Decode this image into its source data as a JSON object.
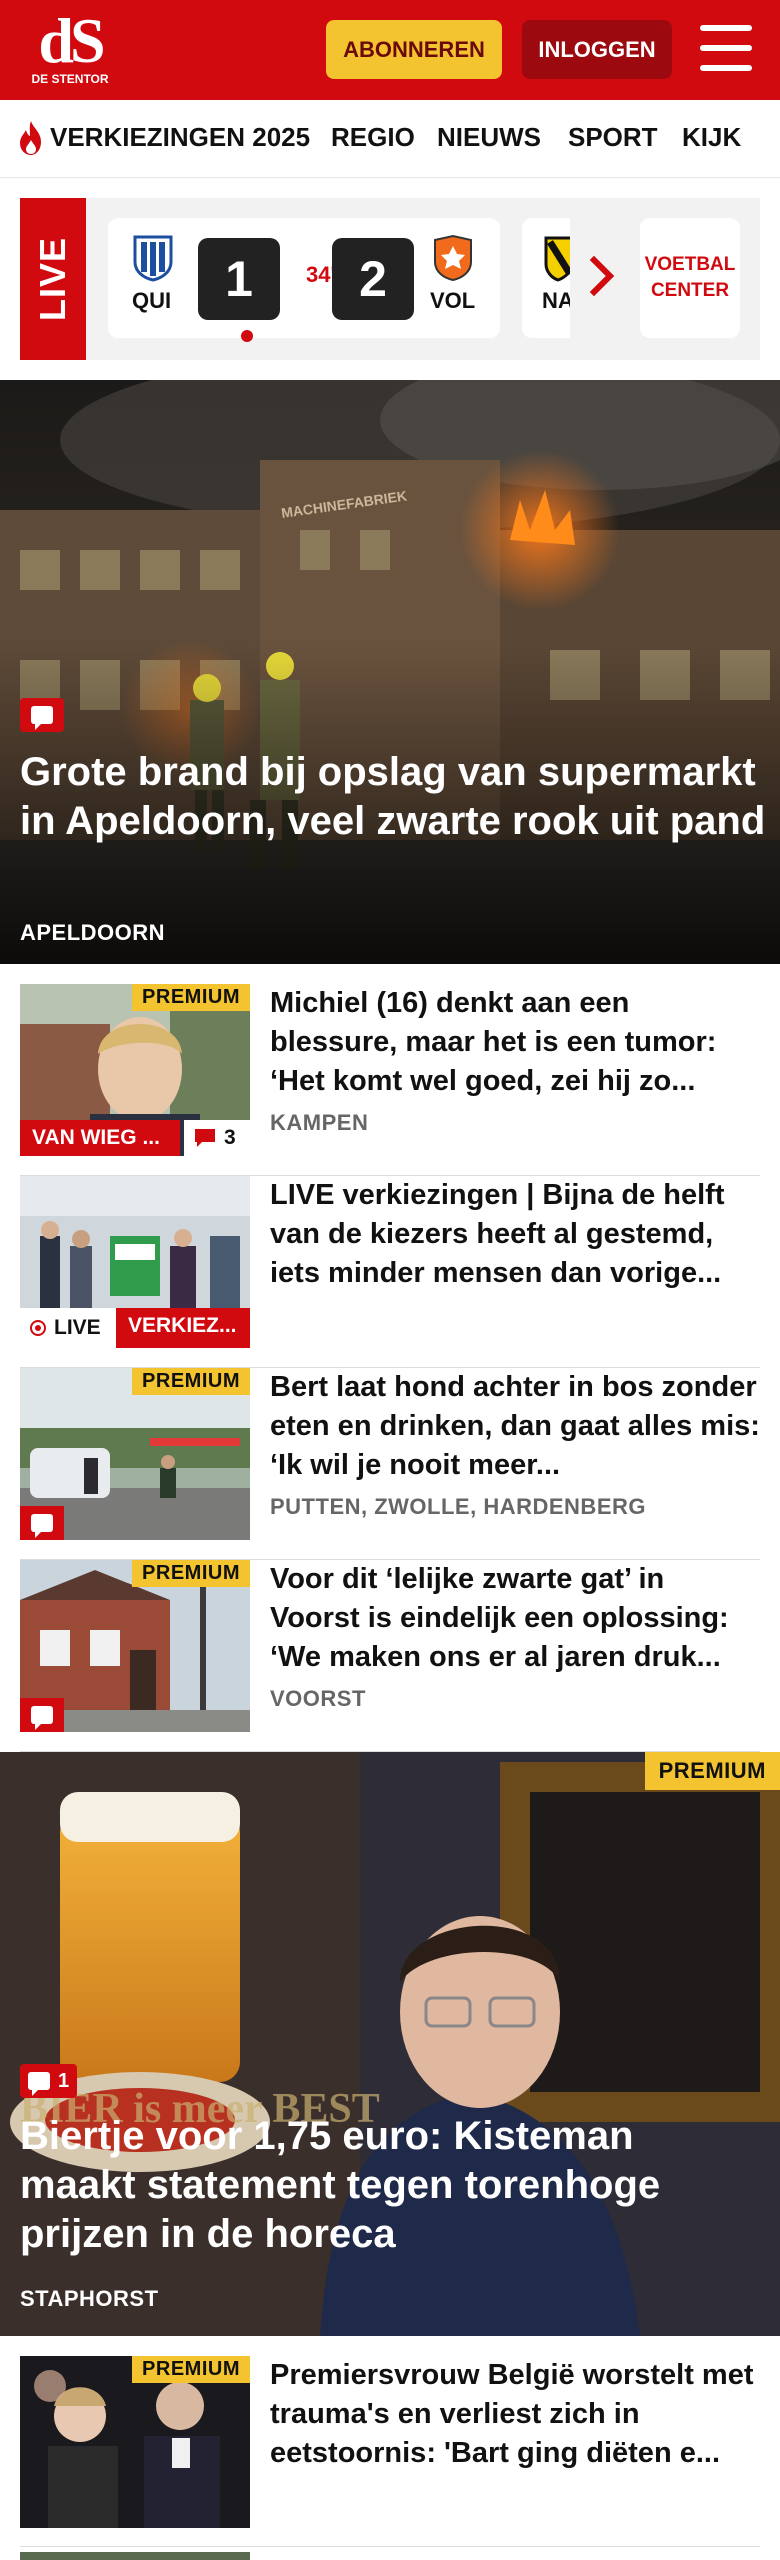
{
  "header": {
    "logo_mark": "dS",
    "logo_sub": "DE STENTOR",
    "subscribe_label": "ABONNEREN",
    "login_label": "INLOGGEN"
  },
  "nav": {
    "items": [
      {
        "label": "VERKIEZINGEN 2025",
        "icon": "flame-icon"
      },
      {
        "label": "REGIO"
      },
      {
        "label": "NIEUWS"
      },
      {
        "label": "SPORT"
      },
      {
        "label": "KIJK"
      }
    ]
  },
  "live": {
    "tag": "LIVE",
    "match": {
      "home_abbr": "QUI",
      "home_score": "1",
      "minute": "34'",
      "away_score": "2",
      "away_abbr": "VOL"
    },
    "next_match_abbr": "NA",
    "voetbal_center": "VOETBAL CENTER"
  },
  "hero": {
    "title": "Grote brand bij opslag van supermarkt in Apeldoorn, veel zwarte rook uit pand",
    "tag": "APELDOORN",
    "building_sign": "MACHINEFABRIEK"
  },
  "articles": [
    {
      "title": "Michiel (16) denkt aan een blessure, maar het is een tumor: ‘Het komt wel goed, zei hij zo...",
      "tag": "KAMPEN",
      "premium": "PREMIUM",
      "label": "VAN WIEG ...",
      "comments": "3"
    },
    {
      "title": "LIVE verkiezingen | Bijna de helft van de kiezers heeft al gestemd, iets minder mensen dan vorige...",
      "live_label": "LIVE",
      "label": "VERKIEZ..."
    },
    {
      "title": "Bert laat hond achter in bos zonder eten en drinken, dan gaat alles mis: ‘Ik wil je nooit meer...",
      "tag": "PUTTEN, ZWOLLE, HARDENBERG",
      "premium": "PREMIUM"
    },
    {
      "title": "Voor dit ‘lelijke zwarte gat’ in Voorst is eindelijk een oplossing: ‘We maken ons er al jaren druk...",
      "tag": "VOORST",
      "premium": "PREMIUM"
    }
  ],
  "feature": {
    "title": "Biertje voor 1,75 euro: Kisteman maakt statement tegen torenhoge prijzen in de horeca",
    "tag": "STAPHORST",
    "premium": "PREMIUM",
    "comments": "1",
    "coaster_text": "BIER is meer BEST"
  },
  "bottom_article": {
    "title": "Premiersvrouw België worstelt met trauma's en verliest zich in eetstoornis: 'Bart ging diëten e...",
    "premium": "PREMIUM"
  },
  "colors": {
    "brand_red": "#d10a10",
    "premium_yellow": "#f4c430",
    "login_dark_red": "#9c0a0f"
  }
}
